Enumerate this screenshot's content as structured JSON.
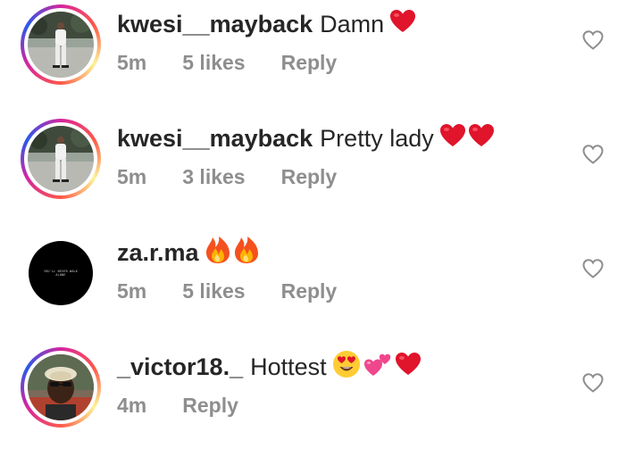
{
  "comments": [
    {
      "username": "kwesi__mayback",
      "text": "Damn",
      "emojis": [
        "red-heart"
      ],
      "time": "5m",
      "likes": "5 likes",
      "reply_label": "Reply"
    },
    {
      "username": "kwesi__mayback",
      "text": "Pretty lady",
      "emojis": [
        "red-heart",
        "red-heart"
      ],
      "time": "5m",
      "likes": "3 likes",
      "reply_label": "Reply"
    },
    {
      "username": "za.r.ma",
      "text": "",
      "emojis": [
        "fire",
        "fire"
      ],
      "time": "5m",
      "likes": "5 likes",
      "reply_label": "Reply"
    },
    {
      "username": "_victor18._",
      "text": "Hottest",
      "emojis": [
        "heart-eyes",
        "two-hearts",
        "red-heart"
      ],
      "time": "4m",
      "likes": "",
      "reply_label": "Reply"
    }
  ],
  "avatar_texts": {
    "zarma": "YOU'LL NEVER WALK ALONE"
  },
  "colors": {
    "text": "#262626",
    "meta": "#8e8e8e",
    "heart": "#e0142b",
    "ring_start": "#d6249f",
    "ring_end": "#fd5949"
  }
}
